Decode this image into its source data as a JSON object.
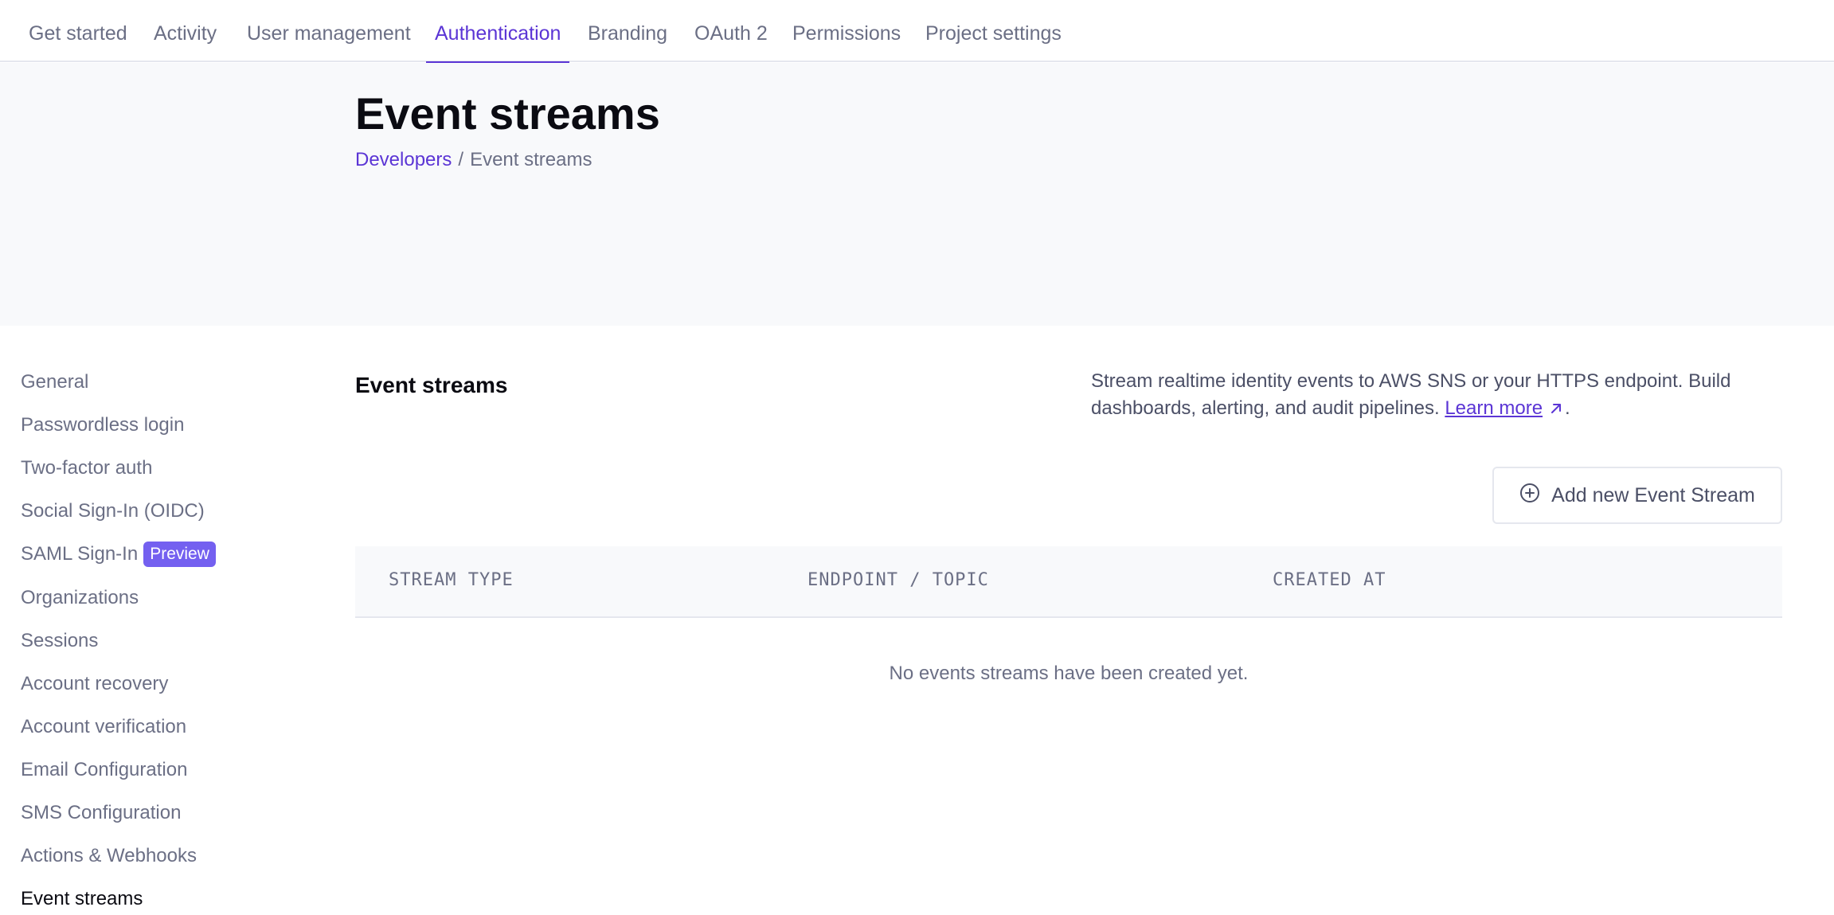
{
  "topnav": {
    "tabs": [
      {
        "label": "Get started"
      },
      {
        "label": "Activity"
      },
      {
        "label": "User management"
      },
      {
        "label": "Authentication",
        "active": true
      },
      {
        "label": "Branding"
      },
      {
        "label": "OAuth 2"
      },
      {
        "label": "Permissions"
      },
      {
        "label": "Project settings"
      }
    ]
  },
  "header": {
    "title": "Event streams",
    "breadcrumb": {
      "parent": "Developers",
      "separator": "/",
      "current": "Event streams"
    }
  },
  "sidebar": {
    "items": [
      {
        "label": "General"
      },
      {
        "label": "Passwordless login"
      },
      {
        "label": "Two-factor auth"
      },
      {
        "label": "Social Sign-In (OIDC)"
      },
      {
        "label": "SAML Sign-In",
        "badge": "Preview"
      },
      {
        "label": "Organizations"
      },
      {
        "label": "Sessions"
      },
      {
        "label": "Account recovery"
      },
      {
        "label": "Account verification"
      },
      {
        "label": "Email Configuration"
      },
      {
        "label": "SMS Configuration"
      },
      {
        "label": "Actions & Webhooks"
      },
      {
        "label": "Event streams",
        "active": true
      }
    ]
  },
  "main": {
    "section_title": "Event streams",
    "description": "Stream realtime identity events to AWS SNS or your HTTPS endpoint. Build dashboards, alerting, and audit pipelines.",
    "learn_more": "Learn more",
    "description_end": ".",
    "add_button": {
      "label": "Add new Event Stream",
      "icon": "plus-circle-icon"
    },
    "table": {
      "columns": [
        "STREAM TYPE",
        "ENDPOINT / TOPIC",
        "CREATED AT"
      ],
      "empty_message": "No events streams have been created yet."
    }
  },
  "colors": {
    "accent": "#5b35d5",
    "badge": "#7460f0",
    "muted_text": "#6b6f85",
    "hero_bg": "#f8f9fb"
  }
}
